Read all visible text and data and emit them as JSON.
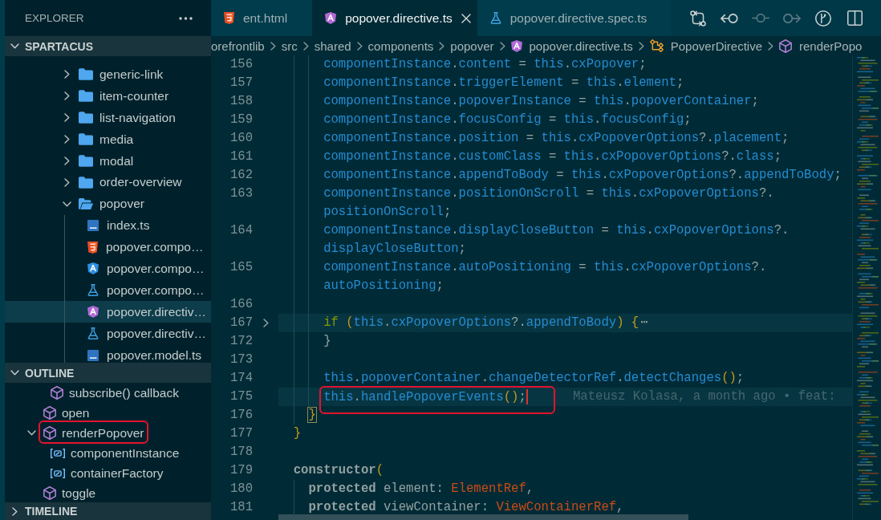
{
  "explorer": {
    "title": "EXPLORER",
    "folder": {
      "label": "SPARTACUS",
      "expanded": true,
      "items": [
        {
          "label": "generic-link",
          "kind": "folder",
          "expanded": false,
          "selected": false
        },
        {
          "label": "item-counter",
          "kind": "folder",
          "expanded": false,
          "selected": false
        },
        {
          "label": "list-navigation",
          "kind": "folder",
          "expanded": false,
          "selected": false
        },
        {
          "label": "media",
          "kind": "folder",
          "expanded": false,
          "selected": false
        },
        {
          "label": "modal",
          "kind": "folder",
          "expanded": false,
          "selected": false
        },
        {
          "label": "order-overview",
          "kind": "folder",
          "expanded": false,
          "selected": false
        },
        {
          "label": "popover",
          "kind": "folder",
          "expanded": true,
          "selected": false,
          "children": [
            {
              "label": "index.ts",
              "kind": "ts",
              "selected": false
            },
            {
              "label": "popover.compo…",
              "kind": "html",
              "selected": false
            },
            {
              "label": "popover.compo…",
              "kind": "component",
              "selected": false
            },
            {
              "label": "popover.compo…",
              "kind": "spec",
              "selected": false
            },
            {
              "label": "popover.directiv…",
              "kind": "directive",
              "selected": true
            },
            {
              "label": "popover.directiv…",
              "kind": "spec",
              "selected": false
            },
            {
              "label": "popover.model.ts",
              "kind": "ts",
              "selected": false
            }
          ]
        }
      ]
    }
  },
  "outline": {
    "label": "OUTLINE",
    "expanded": true,
    "items": [
      {
        "children": [
          {
            "label": "subscribe() callback",
            "kind": "method"
          }
        ]
      },
      {
        "label": "open",
        "kind": "method"
      },
      {
        "label": "renderPopover",
        "kind": "method",
        "expanded": true,
        "annotated": true,
        "children": [
          {
            "label": "componentInstance",
            "kind": "variable"
          },
          {
            "label": "containerFactory",
            "kind": "variable"
          }
        ]
      },
      {
        "label": "toggle",
        "kind": "method"
      }
    ]
  },
  "timeline": {
    "label": "TIMELINE",
    "expanded": false
  },
  "tabs": [
    {
      "label": "ent.html",
      "kind": "html",
      "selected": false
    },
    {
      "label": "popover.directive.ts",
      "kind": "directive",
      "selected": true
    },
    {
      "label": "popover.directive.spec.ts",
      "kind": "spec",
      "selected": false
    }
  ],
  "editor_actions": [
    {
      "kind": "compare",
      "disabled": false
    },
    {
      "kind": "previous",
      "disabled": false
    },
    {
      "kind": "current",
      "disabled": true
    },
    {
      "kind": "next",
      "disabled": true
    },
    {
      "kind": "graph",
      "disabled": false
    },
    {
      "kind": "split",
      "disabled": false
    }
  ],
  "breadcrumbs": [
    {
      "label": "orefrontlib",
      "kind": "folder"
    },
    {
      "label": "src",
      "kind": "folder"
    },
    {
      "label": "shared",
      "kind": "folder"
    },
    {
      "label": "components",
      "kind": "folder"
    },
    {
      "label": "popover",
      "kind": "folder"
    },
    {
      "label": "popover.directive.ts",
      "kind": "directive"
    },
    {
      "label": "PopoverDirective",
      "kind": "class"
    },
    {
      "label": "renderPopo",
      "kind": "method"
    }
  ],
  "editor": {
    "rows": [
      {
        "number": "156",
        "tokens": [
          {
            "text": "      componentInstance",
            "kind": "name"
          },
          {
            "text": ".",
            "kind": "punct"
          },
          {
            "text": "content",
            "kind": "name"
          },
          {
            "text": " = ",
            "kind": "punct"
          },
          {
            "text": "this",
            "kind": "name"
          },
          {
            "text": ".",
            "kind": "punct"
          },
          {
            "text": "cxPopover",
            "kind": "name"
          },
          {
            "text": ";",
            "kind": "punct"
          }
        ]
      },
      {
        "number": "157",
        "tokens": [
          {
            "text": "      componentInstance",
            "kind": "name"
          },
          {
            "text": ".",
            "kind": "punct"
          },
          {
            "text": "triggerElement",
            "kind": "name"
          },
          {
            "text": " = ",
            "kind": "punct"
          },
          {
            "text": "this",
            "kind": "name"
          },
          {
            "text": ".",
            "kind": "punct"
          },
          {
            "text": "element",
            "kind": "name"
          },
          {
            "text": ";",
            "kind": "punct"
          }
        ]
      },
      {
        "number": "158",
        "tokens": [
          {
            "text": "      componentInstance",
            "kind": "name"
          },
          {
            "text": ".",
            "kind": "punct"
          },
          {
            "text": "popoverInstance",
            "kind": "name"
          },
          {
            "text": " = ",
            "kind": "punct"
          },
          {
            "text": "this",
            "kind": "name"
          },
          {
            "text": ".",
            "kind": "punct"
          },
          {
            "text": "popoverContainer",
            "kind": "name"
          },
          {
            "text": ";",
            "kind": "punct"
          }
        ]
      },
      {
        "number": "159",
        "tokens": [
          {
            "text": "      componentInstance",
            "kind": "name"
          },
          {
            "text": ".",
            "kind": "punct"
          },
          {
            "text": "focusConfig",
            "kind": "name"
          },
          {
            "text": " = ",
            "kind": "punct"
          },
          {
            "text": "this",
            "kind": "name"
          },
          {
            "text": ".",
            "kind": "punct"
          },
          {
            "text": "focusConfig",
            "kind": "name"
          },
          {
            "text": ";",
            "kind": "punct"
          }
        ]
      },
      {
        "number": "160",
        "tokens": [
          {
            "text": "      componentInstance",
            "kind": "name"
          },
          {
            "text": ".",
            "kind": "punct"
          },
          {
            "text": "position",
            "kind": "name"
          },
          {
            "text": " = ",
            "kind": "punct"
          },
          {
            "text": "this",
            "kind": "name"
          },
          {
            "text": ".",
            "kind": "punct"
          },
          {
            "text": "cxPopoverOptions",
            "kind": "name"
          },
          {
            "text": "?.",
            "kind": "punct"
          },
          {
            "text": "placement",
            "kind": "name"
          },
          {
            "text": ";",
            "kind": "punct"
          }
        ]
      },
      {
        "number": "161",
        "tokens": [
          {
            "text": "      componentInstance",
            "kind": "name"
          },
          {
            "text": ".",
            "kind": "punct"
          },
          {
            "text": "customClass",
            "kind": "name"
          },
          {
            "text": " = ",
            "kind": "punct"
          },
          {
            "text": "this",
            "kind": "name"
          },
          {
            "text": ".",
            "kind": "punct"
          },
          {
            "text": "cxPopoverOptions",
            "kind": "name"
          },
          {
            "text": "?.",
            "kind": "punct"
          },
          {
            "text": "class",
            "kind": "name"
          },
          {
            "text": ";",
            "kind": "punct"
          }
        ]
      },
      {
        "number": "162",
        "tokens": [
          {
            "text": "      componentInstance",
            "kind": "name"
          },
          {
            "text": ".",
            "kind": "punct"
          },
          {
            "text": "appendToBody",
            "kind": "name"
          },
          {
            "text": " = ",
            "kind": "punct"
          },
          {
            "text": "this",
            "kind": "name"
          },
          {
            "text": ".",
            "kind": "punct"
          },
          {
            "text": "cxPopoverOptions",
            "kind": "name"
          },
          {
            "text": "?.",
            "kind": "punct"
          },
          {
            "text": "appendToBody",
            "kind": "name"
          },
          {
            "text": ";",
            "kind": "punct"
          }
        ]
      },
      {
        "number": "163",
        "tokens": [
          {
            "text": "      componentInstance",
            "kind": "name"
          },
          {
            "text": ".",
            "kind": "punct"
          },
          {
            "text": "positionOnScroll",
            "kind": "name"
          },
          {
            "text": " = ",
            "kind": "punct"
          },
          {
            "text": "this",
            "kind": "name"
          },
          {
            "text": ".",
            "kind": "punct"
          },
          {
            "text": "cxPopoverOptions",
            "kind": "name"
          },
          {
            "text": "?.",
            "kind": "punct"
          }
        ]
      },
      {
        "tokens": [
          {
            "text": "positionOnScroll",
            "kind": "name"
          },
          {
            "text": ";",
            "kind": "punct"
          }
        ]
      },
      {
        "number": "164",
        "tokens": [
          {
            "text": "      componentInstance",
            "kind": "name"
          },
          {
            "text": ".",
            "kind": "punct"
          },
          {
            "text": "displayCloseButton",
            "kind": "name"
          },
          {
            "text": " = ",
            "kind": "punct"
          },
          {
            "text": "this",
            "kind": "name"
          },
          {
            "text": ".",
            "kind": "punct"
          },
          {
            "text": "cxPopoverOptions",
            "kind": "name"
          },
          {
            "text": "?.",
            "kind": "punct"
          }
        ]
      },
      {
        "tokens": [
          {
            "text": "displayCloseButton",
            "kind": "name"
          },
          {
            "text": ";",
            "kind": "punct"
          }
        ]
      },
      {
        "number": "165",
        "tokens": [
          {
            "text": "      componentInstance",
            "kind": "name"
          },
          {
            "text": ".",
            "kind": "punct"
          },
          {
            "text": "autoPositioning",
            "kind": "name"
          },
          {
            "text": " = ",
            "kind": "punct"
          },
          {
            "text": "this",
            "kind": "name"
          },
          {
            "text": ".",
            "kind": "punct"
          },
          {
            "text": "cxPopoverOptions",
            "kind": "name"
          },
          {
            "text": "?.",
            "kind": "punct"
          }
        ]
      },
      {
        "tokens": [
          {
            "text": "autoPositioning",
            "kind": "name"
          },
          {
            "text": ";",
            "kind": "punct"
          }
        ]
      },
      {
        "number": "166"
      },
      {
        "number": "167",
        "highlighted": true,
        "folded": true,
        "tokens": [
          {
            "text": "      if ",
            "kind": "keyword"
          },
          {
            "text": "(",
            "kind": "bracket"
          },
          {
            "text": "this",
            "kind": "name"
          },
          {
            "text": ".",
            "kind": "punct"
          },
          {
            "text": "cxPopoverOptions",
            "kind": "name"
          },
          {
            "text": "?.",
            "kind": "punct"
          },
          {
            "text": "appendToBody",
            "kind": "name"
          },
          {
            "text": ") {",
            "kind": "bracket"
          },
          {
            "text": "⋯",
            "kind": "fold"
          }
        ]
      },
      {
        "number": "172",
        "tokens": [
          {
            "text": "      }",
            "kind": "punct"
          }
        ]
      },
      {
        "number": "173"
      },
      {
        "number": "174",
        "tokens": [
          {
            "text": "      this",
            "kind": "name"
          },
          {
            "text": ".",
            "kind": "punct"
          },
          {
            "text": "popoverContainer",
            "kind": "name"
          },
          {
            "text": ".",
            "kind": "punct"
          },
          {
            "text": "changeDetectorRef",
            "kind": "name"
          },
          {
            "text": ".",
            "kind": "punct"
          },
          {
            "text": "detectChanges",
            "kind": "name"
          },
          {
            "text": "()",
            "kind": "bracket"
          },
          {
            "text": ";",
            "kind": "punct"
          }
        ]
      },
      {
        "number": "175",
        "highlighted": true,
        "cursor": true,
        "annotated": true,
        "blame": "Mateusz Kolasa, a month ago • feat:",
        "tokens": [
          {
            "text": "      this",
            "kind": "name"
          },
          {
            "text": ".",
            "kind": "punct"
          },
          {
            "text": "handlePopoverEvents",
            "kind": "name"
          },
          {
            "text": "()",
            "kind": "bracket"
          },
          {
            "text": ";",
            "kind": "punct"
          }
        ]
      },
      {
        "number": "176",
        "matched_bracket": true,
        "tokens": [
          {
            "text": "    }",
            "kind": "bracket"
          }
        ]
      },
      {
        "number": "177",
        "tokens": [
          {
            "text": "  }",
            "kind": "bracket"
          }
        ]
      },
      {
        "number": "178"
      },
      {
        "number": "179",
        "tokens": [
          {
            "text": "  constructor",
            "kind": "modifier"
          },
          {
            "text": "(",
            "kind": "bracket"
          }
        ]
      },
      {
        "number": "180",
        "tokens": [
          {
            "text": "    protected ",
            "kind": "modifier"
          },
          {
            "text": "element",
            "kind": "param"
          },
          {
            "text": ": ",
            "kind": "punct"
          },
          {
            "text": "ElementRef",
            "kind": "type"
          },
          {
            "text": ",",
            "kind": "punct"
          }
        ]
      },
      {
        "number": "181",
        "tokens": [
          {
            "text": "    protected ",
            "kind": "modifier"
          },
          {
            "text": "viewContainer",
            "kind": "param"
          },
          {
            "text": ": ",
            "kind": "punct"
          },
          {
            "text": "ViewContainerRef",
            "kind": "type"
          },
          {
            "text": ",",
            "kind": "punct"
          }
        ]
      }
    ]
  }
}
